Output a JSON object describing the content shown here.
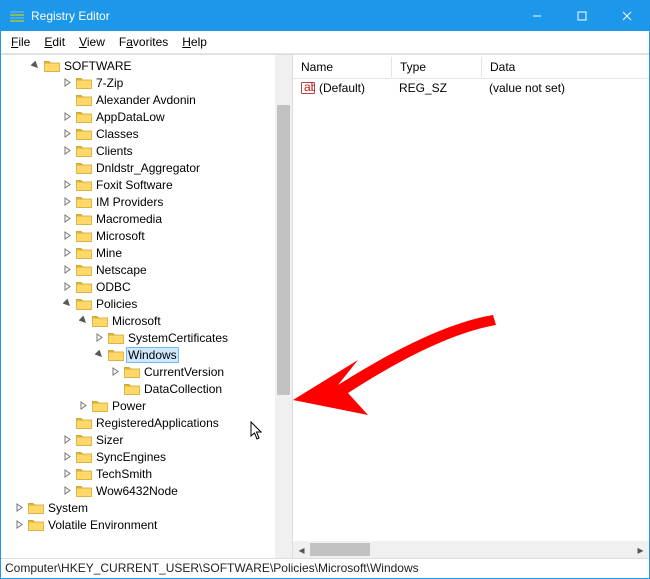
{
  "window": {
    "title": "Registry Editor"
  },
  "menus": [
    "File",
    "Edit",
    "View",
    "Favorites",
    "Help"
  ],
  "tree": {
    "root": "SOFTWARE",
    "items": [
      {
        "label": "7-Zip",
        "exp": "closed"
      },
      {
        "label": "Alexander Avdonin",
        "exp": "none"
      },
      {
        "label": "AppDataLow",
        "exp": "closed"
      },
      {
        "label": "Classes",
        "exp": "closed"
      },
      {
        "label": "Clients",
        "exp": "closed"
      },
      {
        "label": "Dnldstr_Aggregator",
        "exp": "none"
      },
      {
        "label": "Foxit Software",
        "exp": "closed"
      },
      {
        "label": "IM Providers",
        "exp": "closed"
      },
      {
        "label": "Macromedia",
        "exp": "closed"
      },
      {
        "label": "Microsoft",
        "exp": "closed"
      },
      {
        "label": "Mine",
        "exp": "closed"
      },
      {
        "label": "Netscape",
        "exp": "closed"
      },
      {
        "label": "ODBC",
        "exp": "closed"
      },
      {
        "label": "Policies",
        "exp": "open",
        "children": [
          {
            "label": "Microsoft",
            "exp": "open",
            "children": [
              {
                "label": "SystemCertificates",
                "exp": "closed"
              },
              {
                "label": "Windows",
                "exp": "open",
                "selected": true,
                "children": [
                  {
                    "label": "CurrentVersion",
                    "exp": "closed"
                  },
                  {
                    "label": "DataCollection",
                    "exp": "none"
                  }
                ]
              }
            ]
          },
          {
            "label": "Power",
            "exp": "closed"
          }
        ]
      },
      {
        "label": "RegisteredApplications",
        "exp": "none"
      },
      {
        "label": "Sizer",
        "exp": "closed"
      },
      {
        "label": "SyncEngines",
        "exp": "closed"
      },
      {
        "label": "TechSmith",
        "exp": "closed"
      },
      {
        "label": "Wow6432Node",
        "exp": "closed"
      }
    ],
    "after": [
      {
        "label": "System",
        "exp": "closed"
      },
      {
        "label": "Volatile Environment",
        "exp": "closed"
      }
    ]
  },
  "columns": {
    "name": "Name",
    "type": "Type",
    "data": "Data"
  },
  "values": [
    {
      "name": "(Default)",
      "type": "REG_SZ",
      "data": "(value not set)"
    }
  ],
  "status": "Computer\\HKEY_CURRENT_USER\\SOFTWARE\\Policies\\Microsoft\\Windows",
  "colors": {
    "accent": "#1c97ea",
    "folder": "#ffd868",
    "folderEdge": "#caa128",
    "arrow": "#ff0000"
  }
}
